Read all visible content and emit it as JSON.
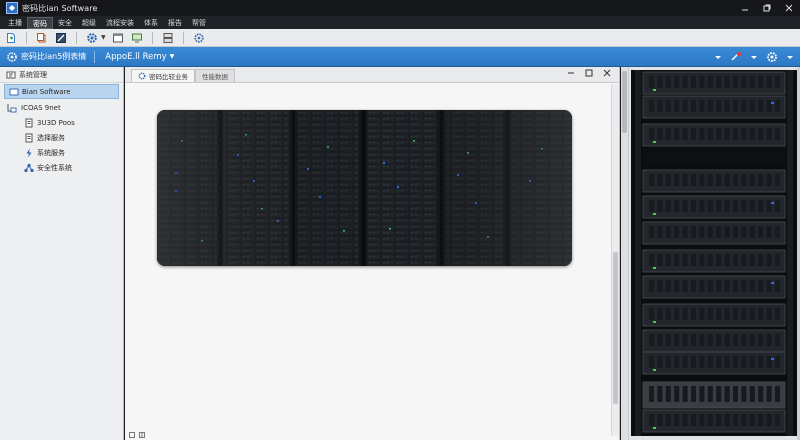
{
  "window": {
    "title": "密码比ian Software"
  },
  "menu": {
    "items": [
      "主播",
      "密码",
      "安全",
      "超级",
      "流程安装",
      "体系",
      "报告",
      "帮管"
    ],
    "active_index": 1
  },
  "address_bar": {
    "title": "密码比ian5例表情",
    "app_name": "AppoE.ll Remy"
  },
  "sidebar": {
    "header": "系统管理",
    "items": [
      {
        "label": "Bian Software",
        "icon": "folder-icon",
        "selected": true
      },
      {
        "label": "ICOAS 9net",
        "icon": "tree-icon"
      },
      {
        "label": "3U3D Poos",
        "icon": "document-icon"
      },
      {
        "label": "选择服务",
        "icon": "document-icon"
      },
      {
        "label": "系统服务",
        "icon": "lightning-icon"
      },
      {
        "label": "安全性系统",
        "icon": "network-icon"
      }
    ]
  },
  "tabs": [
    {
      "label": "密码比较业务",
      "icon": "gear-icon",
      "active": true
    },
    {
      "label": "性能数据",
      "active": false
    }
  ],
  "colors": {
    "accent_blue": "#2d78c4",
    "selection": "#b9d4ee",
    "led_blue": "#2f6cf0",
    "led_green": "#3ccf56"
  }
}
